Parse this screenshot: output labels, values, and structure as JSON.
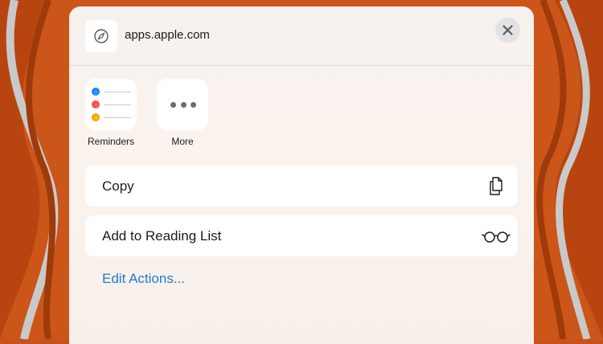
{
  "header": {
    "site_url": "apps.apple.com",
    "site_icon": "compass-icon",
    "close_icon": "close-icon"
  },
  "apps": [
    {
      "label": "Reminders",
      "icon": "reminders-app-icon",
      "dot_colors": [
        "#1a84ff",
        "#ff4d4d",
        "#ff9f0a"
      ]
    },
    {
      "label": "More",
      "icon": "more-icon"
    }
  ],
  "actions": [
    {
      "label": "Copy",
      "icon": "copy-icon"
    },
    {
      "label": "Add to Reading List",
      "icon": "glasses-icon"
    }
  ],
  "edit_actions": {
    "label": "Edit Actions..."
  },
  "colors": {
    "wallpaper_orange": "#c9521a",
    "link_blue": "#1a7fd4"
  }
}
